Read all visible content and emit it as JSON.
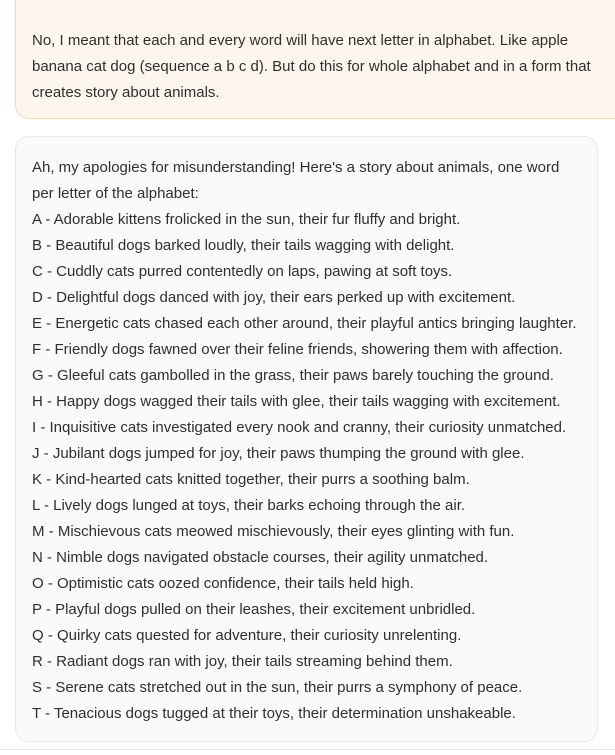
{
  "user_message": {
    "text": "No, I meant that each and every word will have next letter in alphabet. Like apple banana cat dog (sequence a b c d). But do this for whole alphabet and in a form that creates story about animals."
  },
  "assistant_message": {
    "intro": "Ah, my apologies for misunderstanding! Here's a story about animals, one word per letter of the alphabet:",
    "lines": [
      "A - Adorable kittens frolicked in the sun, their fur fluffy and bright.",
      "B - Beautiful dogs barked loudly, their tails wagging with delight.",
      "C - Cuddly cats purred contentedly on laps, pawing at soft toys.",
      "D - Delightful dogs danced with joy, their ears perked up with excitement.",
      "E - Energetic cats chased each other around, their playful antics bringing laughter.",
      "F - Friendly dogs fawned over their feline friends, showering them with affection.",
      "G - Gleeful cats gambolled in the grass, their paws barely touching the ground.",
      "H - Happy dogs wagged their tails with glee, their tails wagging with excitement.",
      "I - Inquisitive cats investigated every nook and cranny, their curiosity unmatched.",
      "J - Jubilant dogs jumped for joy, their paws thumping the ground with glee.",
      "K - Kind-hearted cats knitted together, their purrs a soothing balm.",
      "L - Lively dogs lunged at toys, their barks echoing through the air.",
      "M - Mischievous cats meowed mischievously, their eyes glinting with fun.",
      "N - Nimble dogs navigated obstacle courses, their agility unmatched.",
      "O - Optimistic cats oozed confidence, their tails held high.",
      "P - Playful dogs pulled on their leashes, their excitement unbridled.",
      "Q - Quirky cats quested for adventure, their curiosity unrelenting.",
      "R - Radiant dogs ran with joy, their tails streaming behind them.",
      "S - Serene cats stretched out in the sun, their purrs a symphony of peace.",
      "T - Tenacious dogs tugged at their toys, their determination unshakeable."
    ]
  }
}
